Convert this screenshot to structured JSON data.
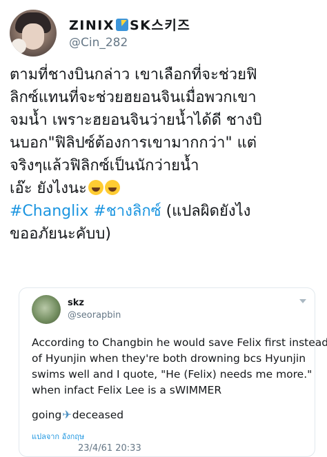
{
  "author": {
    "display_name": "ZINIX",
    "display_name_suffix": "SK스키즈",
    "badge_icon": "lightning-emoji-icon",
    "handle": "@Cin_282"
  },
  "tweet": {
    "lines": [
      "ตามที่ชางบินกล่าว เขาเลือกที่จะช่วยฟิ",
      "ลิกซ์แทนที่จะช่วยฮยอนจินเมื่อพวกเขา",
      "จมน้ำ เพราะฮยอนจินว่ายน้ำได้ดี ชางบิ",
      "นบอก\"ฟิลิปซ์ต้องการเขามากกว่า\" แต่",
      "จริงๆแล้วฟิลิกซ์เป็นนักว่ายน้ำ",
      "เอ๊ะ ยังไงนะ"
    ],
    "hashtag1": "#Changlix",
    "hashtag2": "#ชางลิกซ์",
    "after_hashtags": "(แปลผิดยังไง",
    "last_line": "ขออภัยนะคับบ)",
    "emoji_icons": [
      "laughing-emoji-icon",
      "laughing-emoji-icon"
    ]
  },
  "quote": {
    "name": "skz",
    "handle": "@seorapbin",
    "lines": [
      "According to Changbin he would save Felix first instead",
      "of Hyunjin when they're both drowning bcs Hyunjin",
      "swims well and I quote, \"He (Felix) needs me more.\"",
      "when infact Felix Lee is a sWIMMER"
    ],
    "going": "going",
    "deceased": "deceased",
    "plane_icon": "airplane-emoji-icon",
    "translate_label": "แปลจาก อังกฤษ",
    "timestamp": "23/4/61 20:33"
  }
}
